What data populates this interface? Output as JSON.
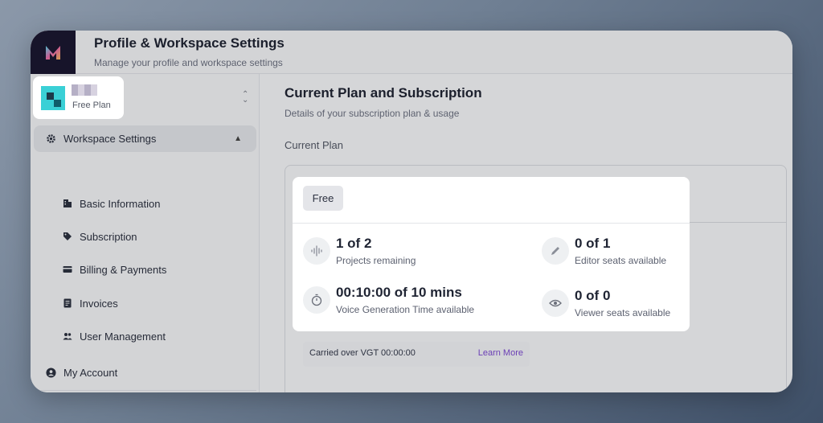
{
  "header": {
    "title": "Profile & Workspace Settings",
    "subtitle": "Manage your profile and workspace settings"
  },
  "workspace": {
    "plan_label": "Free Plan",
    "switch_icon": "chevron-up-down-icon"
  },
  "sidebar": {
    "section": {
      "label": "Workspace Settings",
      "icon": "gear-icon",
      "expanded": true
    },
    "items": [
      {
        "label": "Basic Information",
        "icon": "building-icon"
      },
      {
        "label": "Subscription",
        "icon": "tag-icon"
      },
      {
        "label": "Billing & Payments",
        "icon": "credit-card-icon"
      },
      {
        "label": "Invoices",
        "icon": "document-icon"
      },
      {
        "label": "User Management",
        "icon": "users-icon"
      }
    ],
    "account": {
      "label": "My Account",
      "icon": "user-circle-icon"
    }
  },
  "main": {
    "title": "Current Plan and Subscription",
    "subtitle": "Details of your subscription plan & usage",
    "current_plan_label": "Current Plan"
  },
  "plan": {
    "badge": "Free",
    "stats": [
      {
        "value": "1 of 2",
        "label": "Projects remaining",
        "icon": "waveform-icon"
      },
      {
        "value": "0 of 1",
        "label": "Editor seats available",
        "icon": "pencil-icon"
      },
      {
        "value": "00:10:00 of 10 mins",
        "label": "Voice Generation Time available",
        "icon": "stopwatch-icon"
      },
      {
        "value": "0 of 0",
        "label": "Viewer seats available",
        "icon": "eye-icon"
      }
    ]
  },
  "carryover": {
    "text": "Carried over VGT 00:00:00",
    "link": "Learn More"
  },
  "colors": {
    "accent_link": "#6b3fb5",
    "logo_bg": "#1b1730",
    "avatar": "#3ad0d6"
  }
}
